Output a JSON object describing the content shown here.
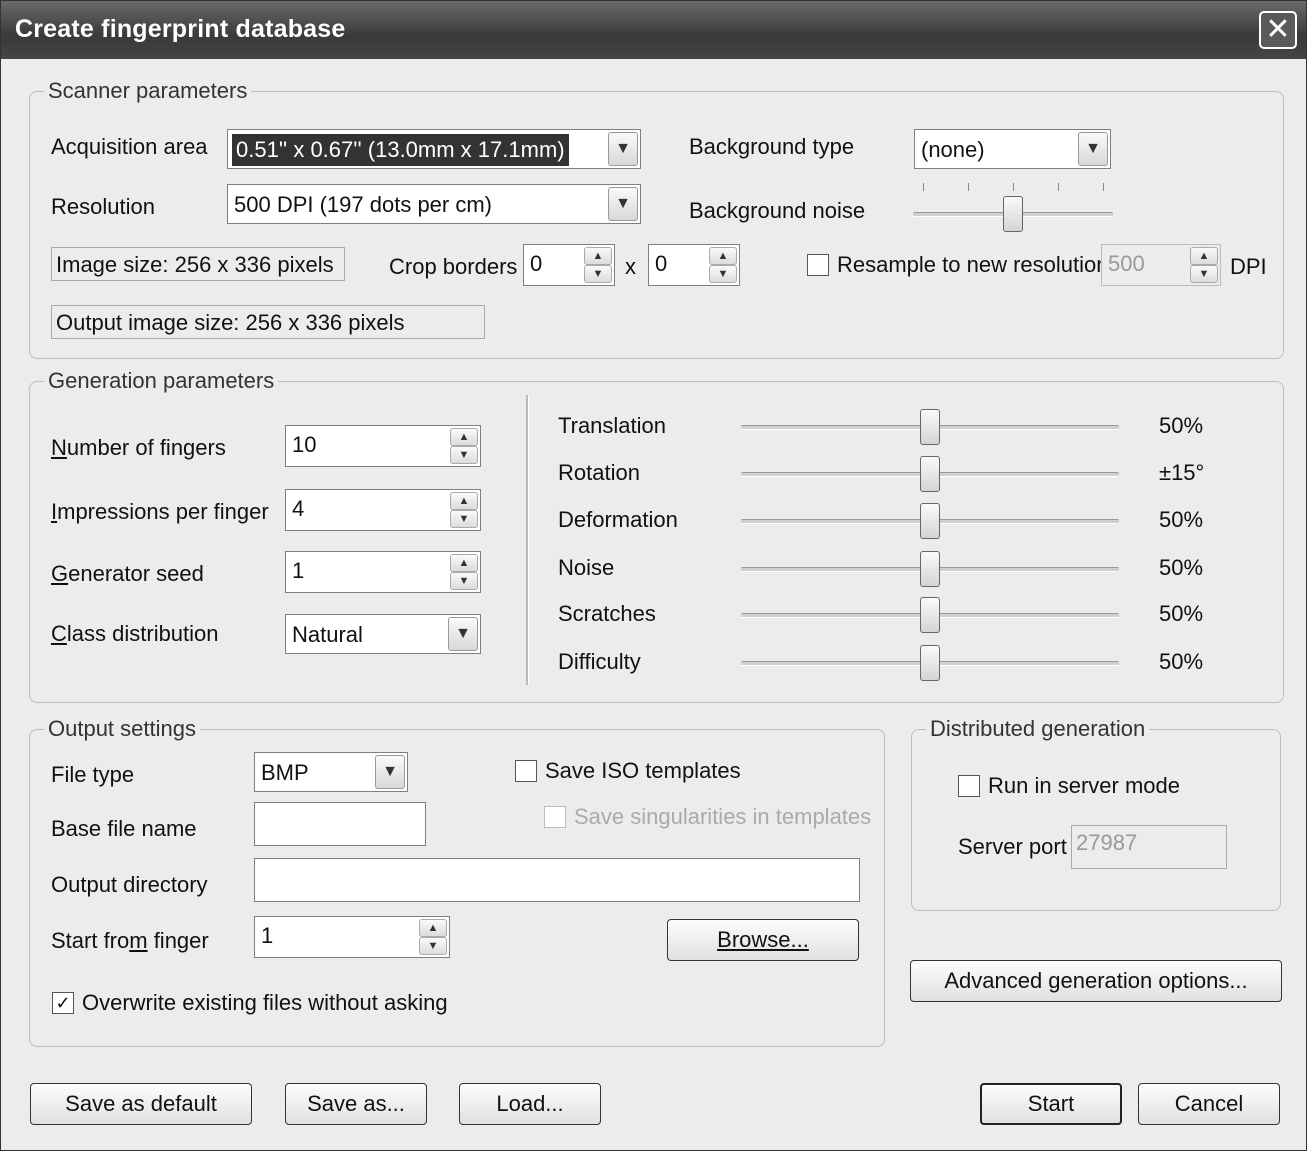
{
  "window": {
    "title": "Create fingerprint database"
  },
  "scanner": {
    "group_label": "Scanner parameters",
    "acquisition_label": "Acquisition area",
    "acquisition_value": "0.51'' x 0.67'' (13.0mm x 17.1mm)",
    "resolution_label": "Resolution",
    "resolution_value": "500 DPI (197 dots per cm)",
    "image_size": "Image size: 256 x 336 pixels",
    "output_image_size": "Output image size: 256 x 336 pixels",
    "crop_label": "Crop borders",
    "crop_x": "0",
    "crop_times": "x",
    "crop_y": "0",
    "background_type_label": "Background type",
    "background_type_value": "(none)",
    "background_noise_label": "Background noise",
    "background_noise_level": 0.5,
    "resample_label": "Resample to new resolution",
    "resample_checked": false,
    "resample_value": "500",
    "dpi_label": "DPI"
  },
  "generation": {
    "group_label": "Generation parameters",
    "fingers_label": "Number of fingers",
    "fingers_value": "10",
    "impressions_label": "Impressions per finger",
    "impressions_value": "4",
    "seed_label": "Generator seed",
    "seed_value": "1",
    "class_label": "Class distribution",
    "class_value": "Natural",
    "sliders": [
      {
        "label": "Translation",
        "value": "50%",
        "level": 0.5
      },
      {
        "label": "Rotation",
        "value": "±15°",
        "level": 0.5
      },
      {
        "label": "Deformation",
        "value": "50%",
        "level": 0.5
      },
      {
        "label": "Noise",
        "value": "50%",
        "level": 0.5
      },
      {
        "label": "Scratches",
        "value": "50%",
        "level": 0.5
      },
      {
        "label": "Difficulty",
        "value": "50%",
        "level": 0.5
      }
    ]
  },
  "output": {
    "group_label": "Output settings",
    "file_type_label": "File type",
    "file_type_value": "BMP",
    "base_name_label": "Base file name",
    "base_name_value": "",
    "directory_label": "Output directory",
    "directory_value": "",
    "start_label": "Start from finger",
    "start_value": "1",
    "save_iso_label": "Save ISO templates",
    "save_iso_checked": false,
    "save_singularities_label": "Save singularities in templates",
    "browse_label": "Browse...",
    "overwrite_label": "Overwrite existing files without asking",
    "overwrite_checked": true
  },
  "distributed": {
    "group_label": "Distributed generation",
    "server_mode_label": "Run in server mode",
    "server_mode_checked": false,
    "port_label": "Server port",
    "port_value": "27987"
  },
  "buttons": {
    "advanced": "Advanced generation options...",
    "save_default": "Save as default",
    "save_as": "Save as...",
    "load": "Load...",
    "start": "Start",
    "cancel": "Cancel"
  }
}
